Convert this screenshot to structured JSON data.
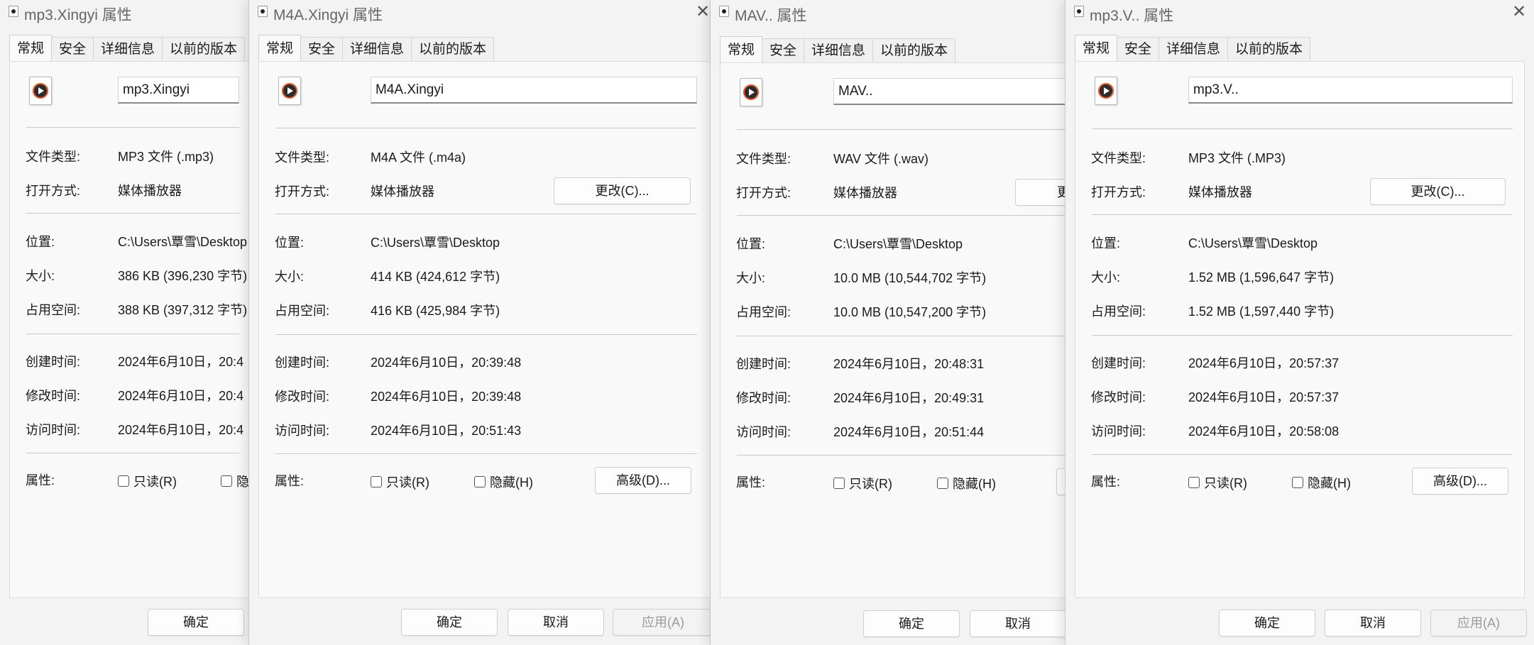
{
  "tabs": [
    "常规",
    "安全",
    "详细信息",
    "以前的版本"
  ],
  "labels": {
    "file_type": "文件类型:",
    "open_with": "打开方式:",
    "location": "位置:",
    "size": "大小:",
    "size_on_disk": "占用空间:",
    "created": "创建时间:",
    "modified": "修改时间:",
    "accessed": "访问时间:",
    "attributes": "属性:"
  },
  "buttons": {
    "change": "更改(C)...",
    "advanced": "高级(D)...",
    "ok": "确定",
    "cancel": "取消",
    "apply": "应用(A)",
    "readonly": "只读(R)",
    "hidden": "隐藏(H)"
  },
  "windows": [
    {
      "title": "mp3.Xingyi 属性",
      "name": "mp3.Xingyi",
      "file_type": "MP3 文件 (.mp3)",
      "open_with": "媒体播放器",
      "location": "C:\\Users\\覃雪\\Desktop",
      "size": "386 KB (396,230 字节)",
      "size_on_disk": "388 KB (397,312 字节)",
      "created": "2024年6月10日，20:4",
      "modified": "2024年6月10日，20:4",
      "accessed": "2024年6月10日，20:4",
      "hidden_partial": "隐"
    },
    {
      "title": "M4A.Xingyi 属性",
      "name": "M4A.Xingyi",
      "file_type": "M4A 文件 (.m4a)",
      "open_with": "媒体播放器",
      "location": "C:\\Users\\覃雪\\Desktop",
      "size": "414 KB (424,612 字节)",
      "size_on_disk": "416 KB (425,984 字节)",
      "created": "2024年6月10日，20:39:48",
      "modified": "2024年6月10日，20:39:48",
      "accessed": "2024年6月10日，20:51:43"
    },
    {
      "title": "MAV.. 属性",
      "name": "MAV..",
      "file_type": "WAV 文件 (.wav)",
      "open_with": "媒体播放器",
      "location": "C:\\Users\\覃雪\\Desktop",
      "size": "10.0 MB (10,544,702 字节)",
      "size_on_disk": "10.0 MB (10,547,200 字节)",
      "created": "2024年6月10日，20:48:31",
      "modified": "2024年6月10日，20:49:31",
      "accessed": "2024年6月10日，20:51:44",
      "change_partial": "更"
    },
    {
      "title": "mp3.V.. 属性",
      "name": "mp3.V..",
      "file_type": "MP3 文件 (.MP3)",
      "open_with": "媒体播放器",
      "location": "C:\\Users\\覃雪\\Desktop",
      "size": "1.52 MB (1,596,647 字节)",
      "size_on_disk": "1.52 MB (1,597,440 字节)",
      "created": "2024年6月10日，20:57:37",
      "modified": "2024年6月10日，20:57:37",
      "accessed": "2024年6月10日，20:58:08"
    }
  ]
}
